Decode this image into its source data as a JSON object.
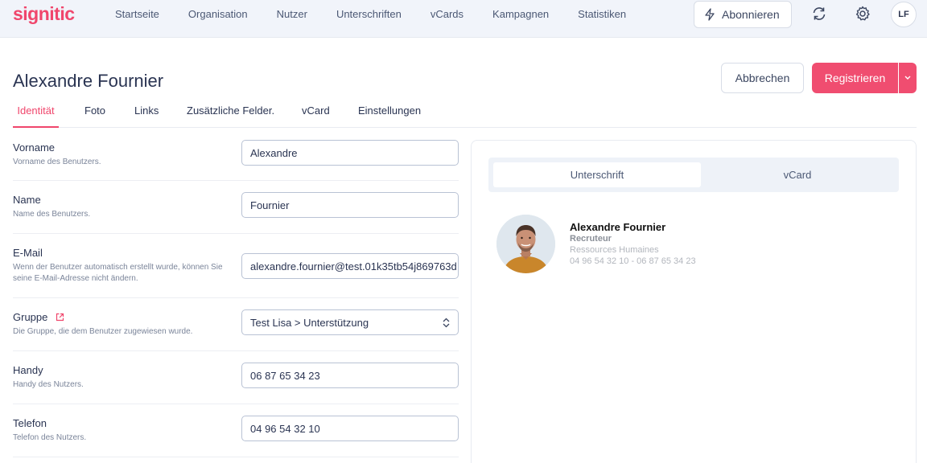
{
  "app": {
    "logo": "signitic",
    "nav": [
      "Startseite",
      "Organisation",
      "Nutzer",
      "Unterschriften",
      "vCards",
      "Kampagnen",
      "Statistiken"
    ],
    "subscribe_label": "Abonnieren",
    "avatar_initials": "LF"
  },
  "header": {
    "title": "Alexandre Fournier",
    "cancel_label": "Abbrechen",
    "register_label": "Registrieren"
  },
  "tabs": [
    "Identität",
    "Foto",
    "Links",
    "Zusätzliche Felder.",
    "vCard",
    "Einstellungen"
  ],
  "form": {
    "fields": [
      {
        "label": "Vorname",
        "help": "Vorname des Benutzers.",
        "value": "Alexandre"
      },
      {
        "label": "Name",
        "help": "Name des Benutzers.",
        "value": "Fournier"
      },
      {
        "label": "E-Mail",
        "help": "Wenn der Benutzer automatisch erstellt wurde, können Sie seine E-Mail-Adresse nicht ändern.",
        "value": "alexandre.fournier@test.01k35tb54j869763d"
      },
      {
        "label": "Gruppe",
        "help": "Die Gruppe, die dem Benutzer zugewiesen wurde.",
        "value": "Test Lisa > Unterstützung"
      },
      {
        "label": "Handy",
        "help": "Handy des Nutzers.",
        "value": "06 87 65 34 23"
      },
      {
        "label": "Telefon",
        "help": "Telefon des Nutzers.",
        "value": "04 96 54 32 10"
      }
    ]
  },
  "preview": {
    "tabs": [
      "Unterschrift",
      "vCard"
    ],
    "signature": {
      "name": "Alexandre Fournier",
      "job": "Recruteur",
      "department": "Ressources Humaines",
      "phones": "04 96 54 32 10 - 06 87 65 34 23"
    }
  },
  "colors": {
    "accent": "#f0466c",
    "text": "#2a3452",
    "nav_bg": "#f1f4fa"
  }
}
